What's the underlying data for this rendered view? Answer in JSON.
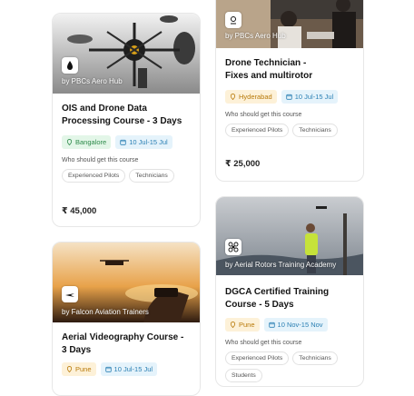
{
  "cards": [
    {
      "provider": "by PBCs Aero Hub",
      "title_lines": [
        "OIS and Drone Data",
        "Processing Course - 3 Days"
      ],
      "location": "Bangalore",
      "dates": "10 Jul-15 Jul",
      "who_label": "Who should get this course",
      "tags": [
        "Experienced Pilots",
        "Technicians"
      ],
      "price": "₹ 45,000"
    },
    {
      "provider": "by PBCs Aero Hub",
      "title_lines": [
        "Drone Technician -",
        "Fixes and multirotor"
      ],
      "location": "Hyderabad",
      "dates": "10 Jul-15 Jul",
      "who_label": "Who should get this course",
      "tags": [
        "Experienced Pilots",
        "Technicians"
      ],
      "price": "₹ 25,000"
    },
    {
      "provider": "by Aerial Rotors Training Academy",
      "title_lines": [
        "DGCA Certified Training",
        "Course - 5 Days"
      ],
      "location": "Pune",
      "dates": "10 Nov-15 Nov",
      "who_label": "Who should get this course",
      "tags": [
        "Experienced Pilots",
        "Technicians",
        "Students"
      ]
    },
    {
      "provider": "by Falcon Aviation Trainers",
      "title_lines": [
        "Aerial Videography Course -",
        "3 Days"
      ],
      "location": "Pune",
      "dates": "10 Jul-15 Jul"
    }
  ],
  "colors": {
    "green_chip_bg": "#e3f6e8",
    "amber_chip_bg": "#fdf1d8",
    "date_chip_bg": "#e5f3fb"
  }
}
